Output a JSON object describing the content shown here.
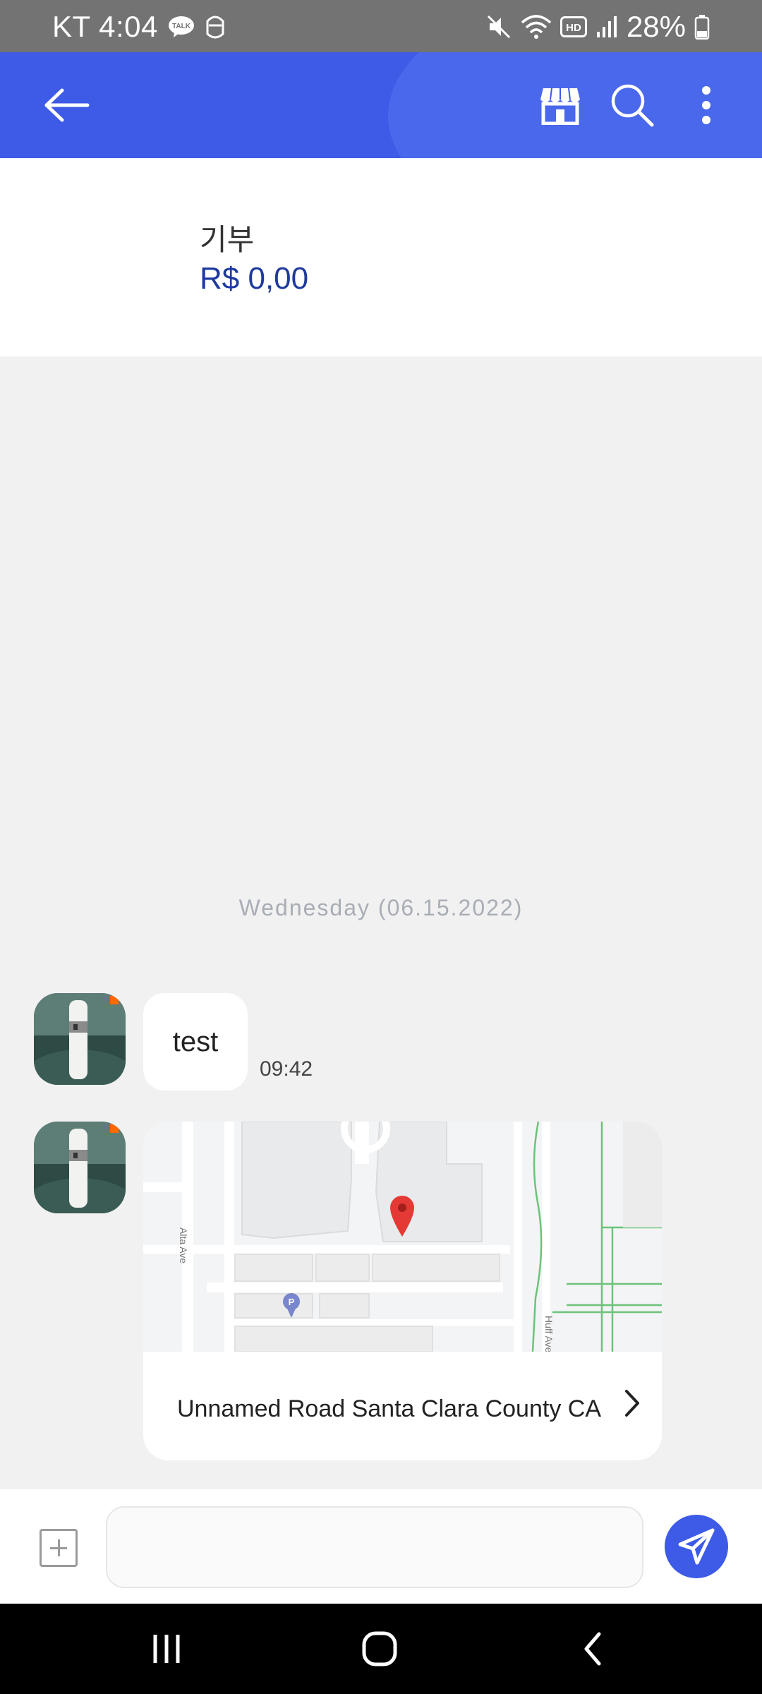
{
  "status_bar": {
    "carrier_time": "KT 4:04",
    "talk_badge": "TALK",
    "battery_pct": "28%",
    "hd_label": "HD",
    "icons": [
      "kakaotalk-icon",
      "notification-icon",
      "mute-icon",
      "wifi-icon",
      "hd-icon",
      "signal-icon",
      "battery-icon"
    ]
  },
  "app_bar": {
    "back_icon": "arrow-left-icon",
    "store_icon": "store-icon",
    "search_icon": "search-icon",
    "more_icon": "more-vertical-icon",
    "color": "#3d5be6"
  },
  "info": {
    "title": "기부",
    "amount": "R$ 0,00"
  },
  "chat": {
    "date_separator": "Wednesday (06.15.2022)",
    "messages": [
      {
        "type": "text",
        "text": "test",
        "time": "09:42"
      },
      {
        "type": "location",
        "address": "Unnamed Road Santa Clara County CA"
      }
    ],
    "map_labels": {
      "street_left": "Alta Ave",
      "street_right": "Huff Ave",
      "parking": "P"
    }
  },
  "composer": {
    "placeholder": "",
    "value": "",
    "attach_icon": "plus-square-icon",
    "send_icon": "send-icon"
  },
  "nav_bar": {
    "icons": [
      "recents-icon",
      "home-icon",
      "back-icon"
    ]
  }
}
